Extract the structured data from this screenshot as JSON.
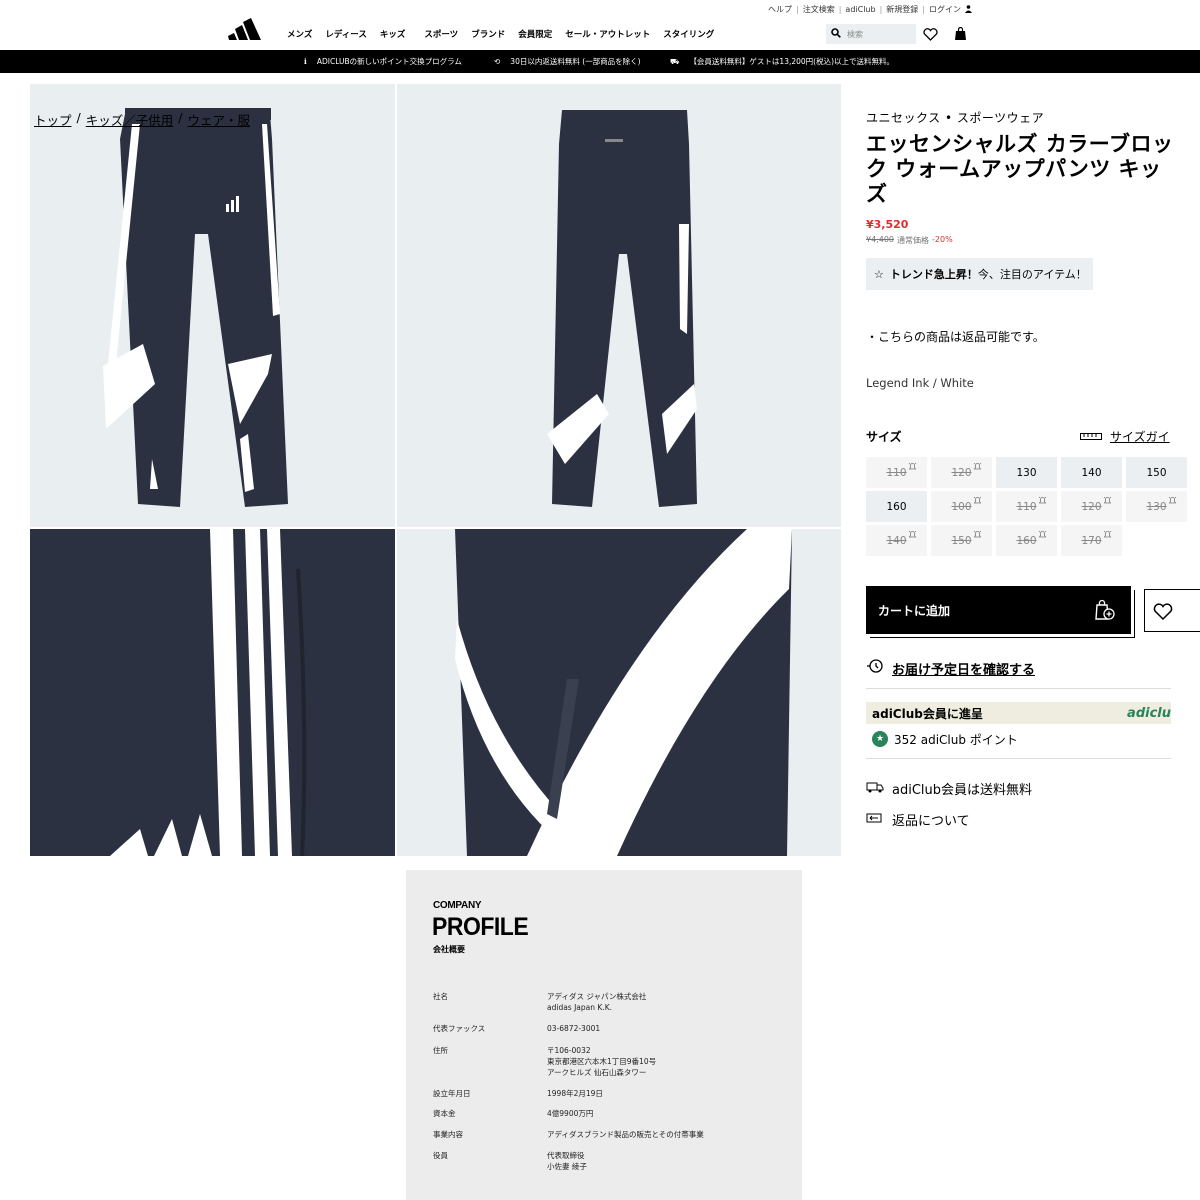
{
  "utility_nav": [
    "ヘルプ",
    "注文検索",
    "adiClub",
    "新規登録",
    "ログイン"
  ],
  "main_nav": [
    "メンズ",
    "レディース",
    "キッズ",
    "スポーツ",
    "ブランド",
    "会員限定",
    "セール・アウトレット",
    "スタイリング"
  ],
  "search": {
    "placeholder": "検索"
  },
  "promo": [
    "ADICLUBの新しいポイント交換プログラム",
    "30日以内返送料無料 (一部商品を除く)",
    "【会員送料無料】ゲストは13,200円(税込)以上で送料無料。"
  ],
  "breadcrumb": [
    "トップ",
    "キッズ／子供用",
    "ウェア・服"
  ],
  "product": {
    "category": "ユニセックス • スポーツウェア",
    "title": "エッセンシャルズ カラーブロック ウォームアップパンツ キッズ",
    "price": "¥3,520",
    "original_price": "¥4,400",
    "original_label": "通常価格",
    "discount": "-20%",
    "trend_bold": "トレンド急上昇！",
    "trend_text": "今、注目のアイテム！",
    "returnable": "・こちらの商品は返品可能です。",
    "color": "Legend Ink / White",
    "size_heading": "サイズ",
    "size_guide": "サイズガイ",
    "sizes": [
      {
        "label": "110",
        "available": false
      },
      {
        "label": "120",
        "available": false
      },
      {
        "label": "130",
        "available": true
      },
      {
        "label": "140",
        "available": true
      },
      {
        "label": "150",
        "available": true
      },
      {
        "label": "160",
        "available": true
      },
      {
        "label": "100",
        "available": false
      },
      {
        "label": "110",
        "available": false
      },
      {
        "label": "120",
        "available": false
      },
      {
        "label": "130",
        "available": false
      },
      {
        "label": "140",
        "available": false
      },
      {
        "label": "150",
        "available": false
      },
      {
        "label": "160",
        "available": false
      },
      {
        "label": "170",
        "available": false
      }
    ],
    "add_to_cart": "カートに追加",
    "delivery_link": "お届け予定日を確認する",
    "adiclub_promo": "adiClub会員に進呈",
    "adiclub_brand": "adiclu",
    "points": "352 adiClub ポイント",
    "shipping": "adiClub会員は送料無料",
    "returns": "返品について"
  },
  "company": {
    "kicker": "COMPANY",
    "heading": "PROFILE",
    "subheading": "会社概要",
    "rows": [
      {
        "label": "社名",
        "lines": [
          "アディダス ジャパン株式会社",
          "adidas Japan K.K."
        ]
      },
      {
        "label": "代表ファックス",
        "lines": [
          "03-6872-3001"
        ]
      },
      {
        "label": "住所",
        "lines": [
          "〒106-0032",
          "東京都港区六本木1丁目9番10号",
          "アークヒルズ 仙石山森タワー"
        ]
      },
      {
        "label": "設立年月日",
        "lines": [
          "1998年2月19日"
        ]
      },
      {
        "label": "資本金",
        "lines": [
          "4億9900万円"
        ]
      },
      {
        "label": "事業内容",
        "lines": [
          "アディダスブランド製品の販売とその付帯事業"
        ]
      },
      {
        "label": "役員",
        "lines": [
          "代表取締役",
          "小佐妻 綾子"
        ]
      }
    ]
  },
  "colors": {
    "accent_red": "#e32b2b",
    "adiclub_green": "#27845b",
    "pants_navy": "#2b3140",
    "gallery_bg": "#e9eef0"
  }
}
